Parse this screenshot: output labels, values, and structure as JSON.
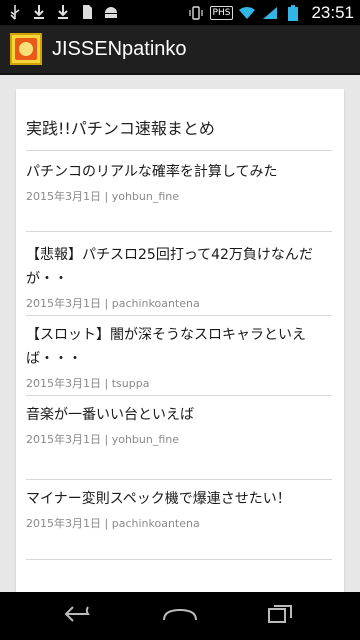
{
  "status_bar": {
    "left_icons": [
      "usb-icon",
      "download-icon",
      "download-icon",
      "sd-card-icon",
      "android-icon"
    ],
    "right_icons": [
      "vibrate-icon",
      "phs-icon",
      "wifi-icon",
      "signal-icon",
      "battery-icon"
    ],
    "phs_label": "PHS",
    "time": "23:51"
  },
  "action_bar": {
    "title": "JISSENpatinko"
  },
  "main": {
    "card_title": "実践!!パチンコ速報まとめ",
    "items": [
      {
        "title": "パチンコのリアルな確率を計算してみた",
        "date": "2015年3月1日",
        "separator": "|",
        "source": "yohbun_fine"
      },
      {
        "title": "【悲報】パチスロ25回打って42万負けなんだが・・",
        "date": "2015年3月1日",
        "separator": "|",
        "source": "pachinkoantena"
      },
      {
        "title": "【スロット】闇が深そうなスロキャラといえば・・・",
        "date": "2015年3月1日",
        "separator": "|",
        "source": "tsuppa"
      },
      {
        "title": "音楽が一番いい台といえば",
        "date": "2015年3月1日",
        "separator": "|",
        "source": "yohbun_fine"
      },
      {
        "title": "マイナー変則スペック機で爆連させたい！",
        "date": "2015年3月1日",
        "separator": "|",
        "source": "pachinkoantena"
      }
    ]
  },
  "nav_bar": {
    "buttons": [
      "back-icon",
      "home-icon",
      "recent-apps-icon"
    ]
  },
  "colors": {
    "status_bar_bg": "#000000",
    "action_bar_bg": "#1f1f1f",
    "content_bg": "#e7e7e7",
    "card_bg": "#ffffff",
    "meta_text": "#8a8a8a"
  }
}
